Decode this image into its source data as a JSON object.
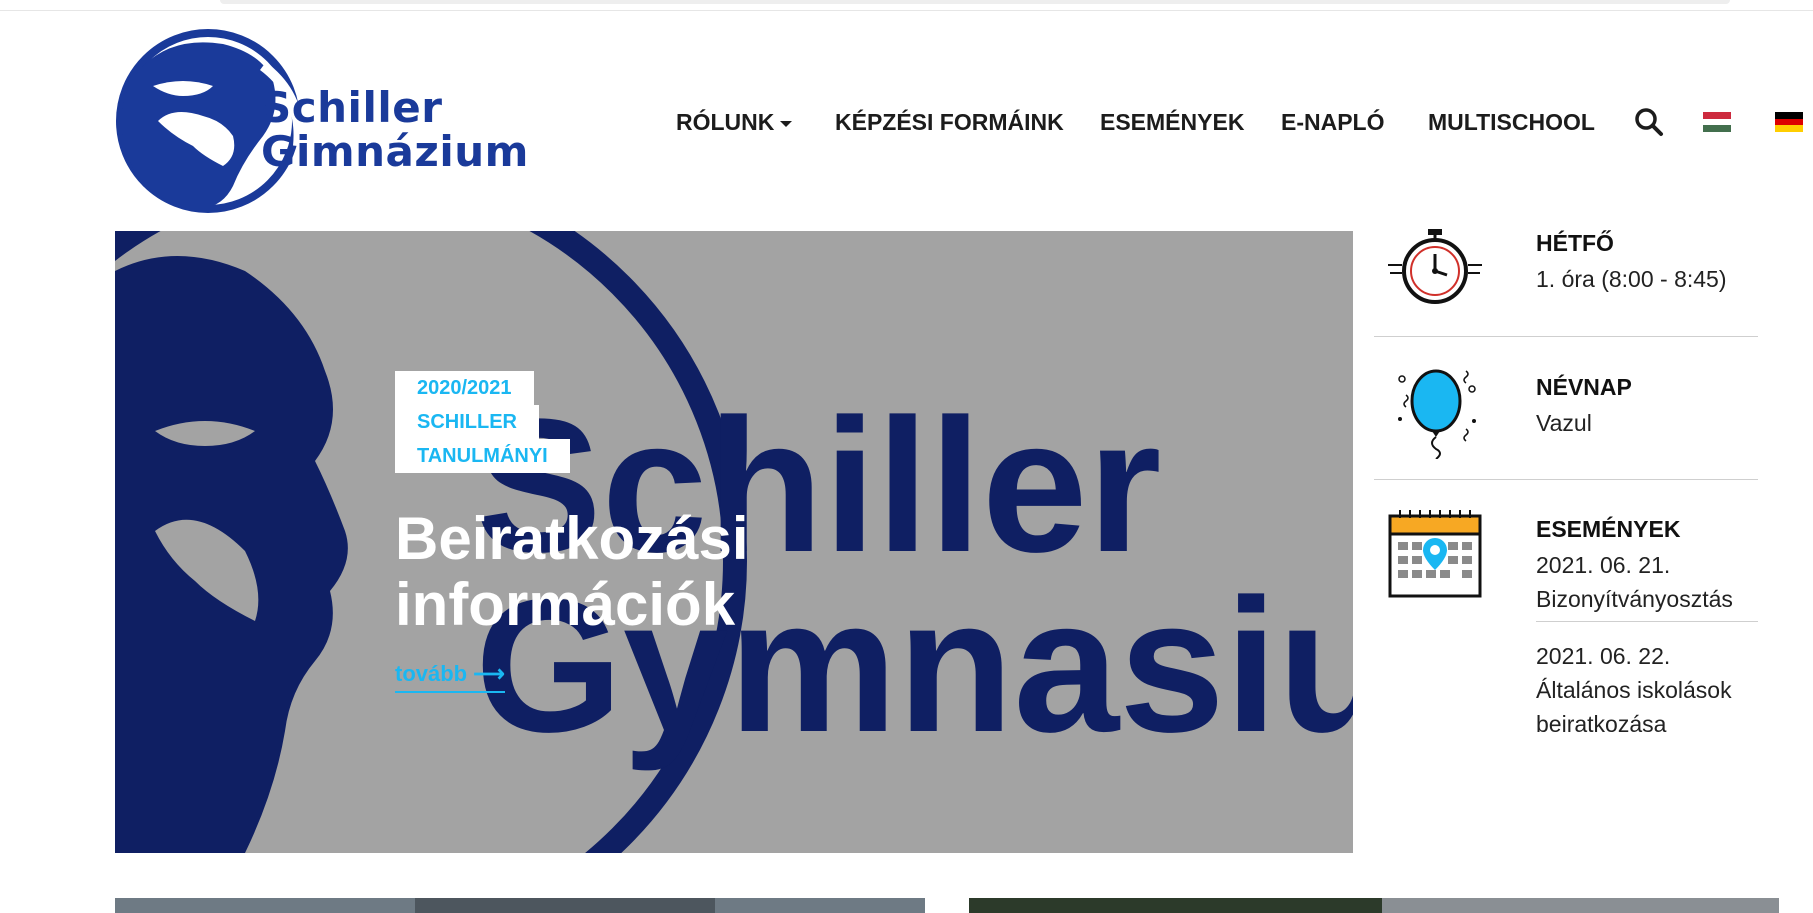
{
  "logo": {
    "line1": "Schiller",
    "line2": "Gimnázium"
  },
  "nav": {
    "items": [
      {
        "label": "RÓLUNK",
        "has_dropdown": true
      },
      {
        "label": "KÉPZÉSI FORMÁINK"
      },
      {
        "label": "ESEMÉNYEK"
      },
      {
        "label": "E-NAPLÓ"
      },
      {
        "label": "MULTISCHOOL"
      }
    ],
    "search_icon": "search-icon",
    "languages": [
      "hungarian-flag-icon",
      "german-flag-icon"
    ]
  },
  "hero": {
    "background_words": {
      "line1": "Schiller",
      "line2": "Gymnasiur"
    },
    "tags": [
      "2020/2021",
      "SCHILLER",
      "TANULMÁNYI"
    ],
    "title_line1": "Beiratkozási",
    "title_line2": "információk",
    "more_link": "tovább ⟶"
  },
  "sidebar": {
    "day": {
      "title": "HÉTFŐ",
      "text": "1. óra (8:00 - 8:45)",
      "icon": "stopwatch-icon"
    },
    "nameday": {
      "title": "NÉVNAP",
      "text": "Vazul",
      "icon": "balloon-icon"
    },
    "events": {
      "title": "ESEMÉNYEK",
      "icon": "calendar-icon",
      "items": [
        {
          "date": "2021. 06. 21.",
          "name": "Bizonyítványosztás"
        },
        {
          "date": "2021. 06. 22.",
          "name": "Általános iskolások beiratkozása"
        }
      ]
    }
  },
  "colors": {
    "brand_blue": "#1a3a9a",
    "accent_cyan": "#1ab7f2",
    "hero_gray": "#a3a3a3",
    "navy": "#0f1f63"
  }
}
